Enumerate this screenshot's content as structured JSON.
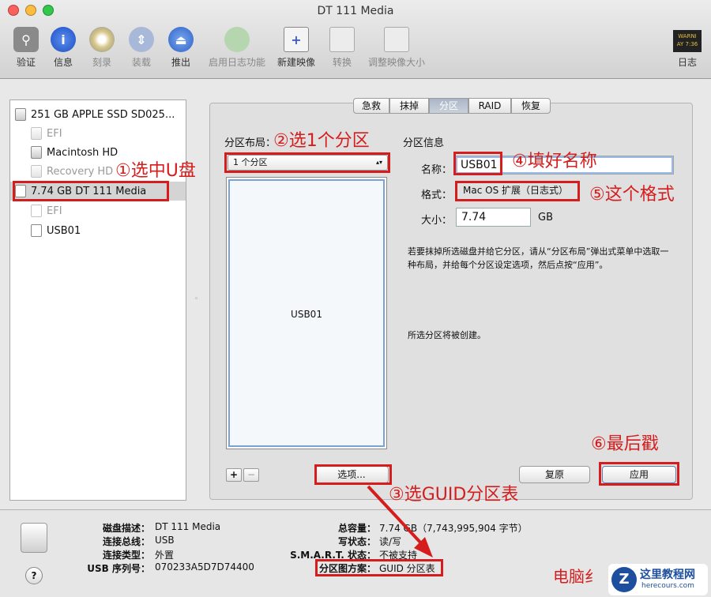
{
  "window": {
    "title": "DT 111 Media"
  },
  "toolbar": {
    "verify": "验证",
    "info": "信息",
    "burn": "刻录",
    "mount": "装载",
    "eject": "推出",
    "enable_journal": "启用日志功能",
    "new_image": "新建映像",
    "convert": "转换",
    "resize_image": "调整映像大小",
    "log": "日志",
    "log_badge": "WARNI\nAY 7:36"
  },
  "sidebar": {
    "items": [
      {
        "label": "251 GB APPLE SSD SD025..."
      },
      {
        "label": "EFI"
      },
      {
        "label": "Macintosh HD"
      },
      {
        "label": "Recovery HD"
      },
      {
        "label": "7.74 GB DT 111 Media"
      },
      {
        "label": "EFI"
      },
      {
        "label": "USB01"
      }
    ]
  },
  "tabs": [
    "急救",
    "抹掉",
    "分区",
    "RAID",
    "恢复"
  ],
  "partition": {
    "layout_label": "分区布局：",
    "layout_value": "1 个分区",
    "info_label": "分区信息",
    "name_label": "名称：",
    "name_value": "USB01",
    "format_label": "格式：",
    "format_value": "Mac OS 扩展（日志式）",
    "size_label": "大小：",
    "size_value": "7.74",
    "size_unit": "GB",
    "help_text": "若要抹掉所选磁盘并给它分区，请从“分区布局”弹出式菜单中选取一种布局，并给每个分区设定选项，然后点按“应用”。",
    "status_text": "所选分区将被创建。",
    "map_partition_label": "USB01",
    "add": "+",
    "remove": "−",
    "options_button": "选项...",
    "revert_button": "复原",
    "apply_button": "应用"
  },
  "annotations": {
    "a1": "①选中U盘",
    "a2": "②选1个分区",
    "a3": "③选GUID分区表",
    "a4": "④填好名称",
    "a5": "⑤这个格式",
    "a6": "⑥最后戳"
  },
  "footer": {
    "desc_label": "磁盘描述：",
    "desc_value": "DT 111 Media",
    "bus_label": "连接总线：",
    "bus_value": "USB",
    "type_label": "连接类型：",
    "type_value": "外置",
    "serial_label": "USB 序列号：",
    "serial_value": "070233A5D7D74400",
    "capacity_label": "总容量：",
    "capacity_value": "7.74 GB（7,743,995,904 字节）",
    "write_label": "写状态：",
    "write_value": "读/写",
    "smart_label": "S.M.A.R.T. 状态：",
    "smart_value": "不被支持",
    "scheme_label": "分区图方案：",
    "scheme_value": "GUID 分区表",
    "help": "?"
  },
  "watermark": {
    "site": "这里教程网",
    "url": "herecours.com",
    "text": "电脑纟"
  },
  "colors": {
    "annotation": "#d51d1d",
    "selection": "#d4d4d4"
  }
}
